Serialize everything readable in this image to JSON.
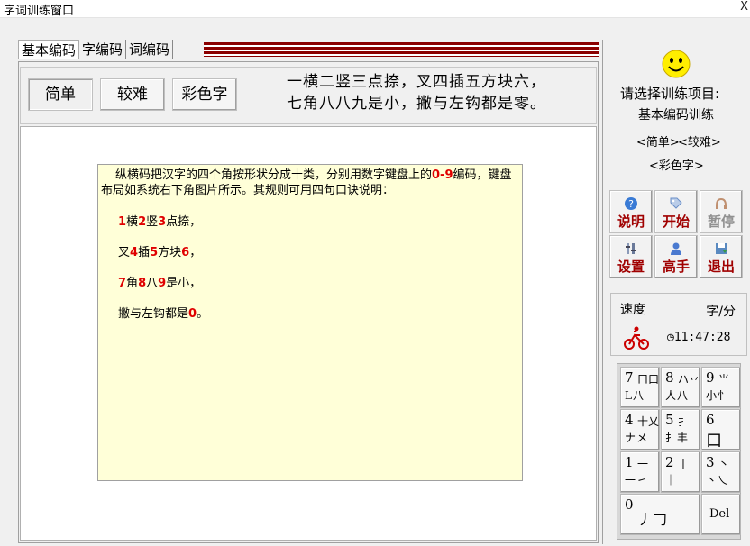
{
  "window": {
    "title": "字词训练窗口",
    "close_label": "X"
  },
  "tabs": [
    {
      "label": "基本编码"
    },
    {
      "label": "字编码"
    },
    {
      "label": "词编码"
    }
  ],
  "toolbar": {
    "simple": "简单",
    "hard": "较难",
    "color": "彩色字"
  },
  "rhyme": {
    "line1": "一横二竖三点捺，叉四插五方块六，",
    "line2": "七角八八九是小，撇与左钩都是零。"
  },
  "note": {
    "intro_a": "纵横码把汉字的四个角按形状分成十类，分别用数字键盘上的",
    "intro_range": "0-9",
    "intro_b": "编码，键盘布局如系统右下角图片所示。其规则可用四句口诀说明：",
    "lines": [
      {
        "parts": [
          {
            "t": "1",
            "r": true
          },
          {
            "t": "横",
            "r": false
          },
          {
            "t": "2",
            "r": true
          },
          {
            "t": "竖",
            "r": false
          },
          {
            "t": "3",
            "r": true
          },
          {
            "t": "点捺，",
            "r": false
          }
        ]
      },
      {
        "parts": [
          {
            "t": "叉",
            "r": false
          },
          {
            "t": "4",
            "r": true
          },
          {
            "t": "插",
            "r": false
          },
          {
            "t": "5",
            "r": true
          },
          {
            "t": "方块",
            "r": false
          },
          {
            "t": "6",
            "r": true
          },
          {
            "t": "，",
            "r": false
          }
        ]
      },
      {
        "parts": [
          {
            "t": "7",
            "r": true
          },
          {
            "t": "角",
            "r": false
          },
          {
            "t": "8",
            "r": true
          },
          {
            "t": "八",
            "r": false
          },
          {
            "t": "9",
            "r": true
          },
          {
            "t": "是小，",
            "r": false
          }
        ]
      },
      {
        "parts": [
          {
            "t": "撇与左钩都是",
            "r": false
          },
          {
            "t": "0",
            "r": true
          },
          {
            "t": "。",
            "r": false
          }
        ]
      }
    ]
  },
  "side": {
    "prompt": "请选择训练项目:",
    "mode": "基本编码训练",
    "choice_simple": "<简单>",
    "choice_hard": "<较难>",
    "choice_color": "<彩色字>"
  },
  "actions": [
    {
      "label": "说明",
      "icon": "help-icon",
      "color": "#3a7bd5"
    },
    {
      "label": "开始",
      "icon": "tag-icon",
      "color": "#6a8fc8"
    },
    {
      "label": "暂停",
      "icon": "headphone-icon",
      "color": "#c0a080"
    },
    {
      "label": "设置",
      "icon": "settings-icon",
      "color": "#6a7a9a"
    },
    {
      "label": "高手",
      "icon": "user-icon",
      "color": "#4a7ad0"
    },
    {
      "label": "退出",
      "icon": "save-exit-icon",
      "color": "#3a9a4a"
    }
  ],
  "speed": {
    "label": "速度",
    "unit": "字/分",
    "time": "11:47:28"
  },
  "keypad": [
    {
      "n": "7",
      "g": "L八",
      "g2": "ㄇ口"
    },
    {
      "n": "8",
      "g": "人八",
      "g2": "ハ丷"
    },
    {
      "n": "9",
      "g": "小忄",
      "g2": "⺌"
    },
    {
      "n": "4",
      "g": "ナメ",
      "g2": "十乂"
    },
    {
      "n": "5",
      "g": "扌丰",
      "g2": "扌"
    },
    {
      "n": "6",
      "g": " 口",
      "g2": ""
    },
    {
      "n": "1",
      "g": "一㇀",
      "g2": "一"
    },
    {
      "n": "2",
      "g": " ｜",
      "g2": "丨"
    },
    {
      "n": "3",
      "g": "丶乀",
      "g2": "丶"
    },
    {
      "n": "0",
      "g": "丿𠃌",
      "g2": ""
    },
    {
      "n": "Del",
      "g": "",
      "g2": ""
    }
  ]
}
